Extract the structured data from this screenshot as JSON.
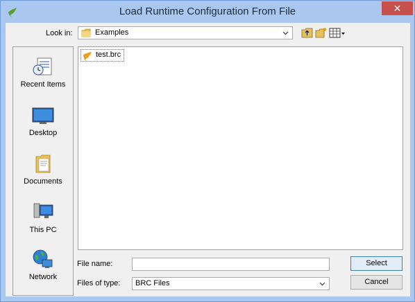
{
  "window": {
    "title": "Load Runtime Configuration From File",
    "close_glyph": "✕"
  },
  "lookin": {
    "label": "Look in:",
    "value": "Examples",
    "icon": "folder-icon"
  },
  "toolbar": {
    "icons": [
      "up-one-level-icon",
      "create-new-folder-icon",
      "view-menu-icon"
    ]
  },
  "places": [
    {
      "label": "Recent Items",
      "icon": "recent-items-icon"
    },
    {
      "label": "Desktop",
      "icon": "desktop-icon"
    },
    {
      "label": "Documents",
      "icon": "documents-icon"
    },
    {
      "label": "This PC",
      "icon": "computer-icon"
    },
    {
      "label": "Network",
      "icon": "network-icon"
    }
  ],
  "files": [
    {
      "name": "test.brc",
      "icon": "brc-file-icon"
    }
  ],
  "form": {
    "filename_label": "File name:",
    "filename_value": "",
    "filetype_label": "Files of type:",
    "filetype_value": "BRC Files"
  },
  "buttons": {
    "select": "Select",
    "cancel": "Cancel"
  },
  "colors": {
    "frame": "#a9c7ef",
    "close": "#c7504d",
    "client": "#f0f0f0"
  }
}
